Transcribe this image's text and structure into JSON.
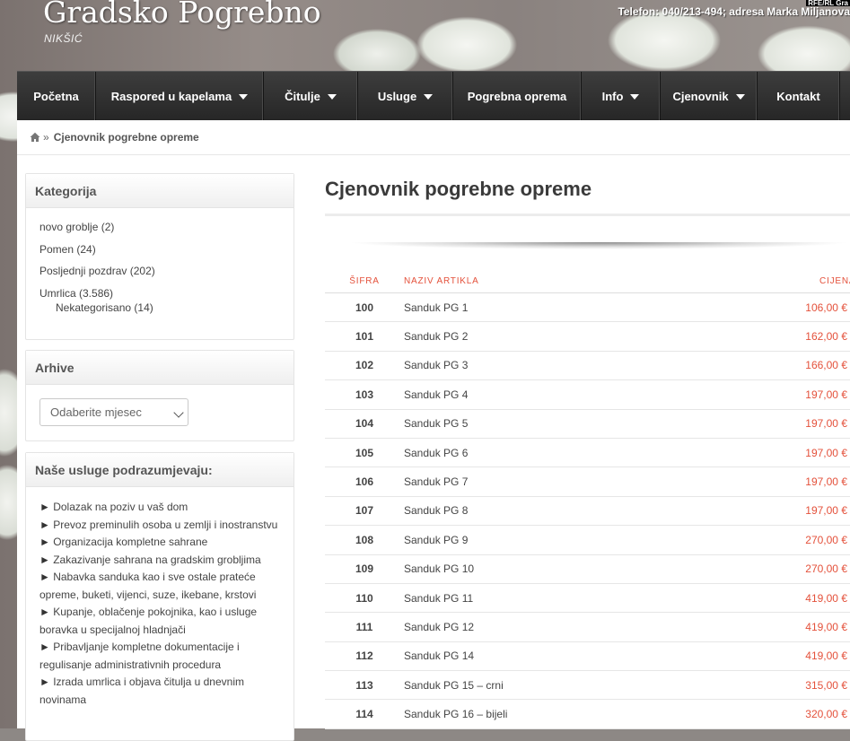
{
  "header": {
    "title": "Gradsko Pogrebno",
    "subtitle": "NIKŠIĆ",
    "contact": "Telefon: 040/213-494; adresa Marka Miljanova",
    "corner_badge": "RFE/RL Gra"
  },
  "nav": {
    "items": [
      {
        "label": "Početna",
        "has_dropdown": false
      },
      {
        "label": "Raspored u kapelama",
        "has_dropdown": true
      },
      {
        "label": "Čitulje",
        "has_dropdown": true
      },
      {
        "label": "Usluge",
        "has_dropdown": true
      },
      {
        "label": "Pogrebna oprema",
        "has_dropdown": false
      },
      {
        "label": "Info",
        "has_dropdown": true
      },
      {
        "label": "Cjenovnik",
        "has_dropdown": true
      },
      {
        "label": "Kontakt",
        "has_dropdown": false
      }
    ]
  },
  "breadcrumb": {
    "separator": "»",
    "current": "Cjenovnik pogrebne opreme",
    "home_icon": "home-icon"
  },
  "sidebar": {
    "categories": {
      "title": "Kategorija",
      "items": [
        {
          "label": "novo groblje",
          "count": "(2)"
        },
        {
          "label": "Pomen",
          "count": "(24)"
        },
        {
          "label": "Posljednji pozdrav",
          "count": "(202)"
        },
        {
          "label": "Umrlica",
          "count": "(3.586)"
        },
        {
          "label": "Nekategorisano",
          "count": "(14)"
        }
      ]
    },
    "archive": {
      "title": "Arhive",
      "select_value": "Odaberite mjesec"
    },
    "services": {
      "title": "Naše usluge podrazumjevaju:",
      "items": [
        "Dolazak na poziv u vaš dom",
        "Prevoz preminulih osoba u zemlji i inostranstvu",
        "Organizacija kompletne sahrane",
        "Zakazivanje sahrana na gradskim grobljima",
        "Nabavka sanduka kao i sve ostale prateće opreme, buketi, vijenci, suze, ikebane, krstovi",
        "Kupanje, oblačenje pokojnika, kao i usluge boravka u specijalnoj hladnjači",
        "Pribavljanje kompletne dokumentacije i regulisanje administrativnih procedura",
        "Izrada umrlica i objava čitulja u dnevnim novinama"
      ]
    }
  },
  "content": {
    "title": "Cjenovnik pogrebne opreme",
    "table": {
      "headers": [
        "ŠIFRA",
        "NAZIV ARTIKLA",
        "CIJENA"
      ],
      "rows": [
        {
          "code": "100",
          "name": "Sanduk PG 1",
          "price": "106,00 €"
        },
        {
          "code": "101",
          "name": "Sanduk PG 2",
          "price": "162,00 €"
        },
        {
          "code": "102",
          "name": "Sanduk PG 3",
          "price": "166,00 €"
        },
        {
          "code": "103",
          "name": "Sanduk PG 4",
          "price": "197,00 €"
        },
        {
          "code": "104",
          "name": "Sanduk PG 5",
          "price": "197,00 €"
        },
        {
          "code": "105",
          "name": "Sanduk PG 6",
          "price": "197,00 €"
        },
        {
          "code": "106",
          "name": "Sanduk PG 7",
          "price": "197,00 €"
        },
        {
          "code": "107",
          "name": "Sanduk PG 8",
          "price": "197,00 €"
        },
        {
          "code": "108",
          "name": "Sanduk PG 9",
          "price": "270,00 €"
        },
        {
          "code": "109",
          "name": "Sanduk PG 10",
          "price": "270,00 €"
        },
        {
          "code": "110",
          "name": "Sanduk PG 11",
          "price": "419,00 €"
        },
        {
          "code": "111",
          "name": "Sanduk PG 12",
          "price": "419,00 €"
        },
        {
          "code": "112",
          "name": "Sanduk PG 14",
          "price": "419,00 €"
        },
        {
          "code": "113",
          "name": "Sanduk PG 15 – crni",
          "price": "315,00 €"
        },
        {
          "code": "114",
          "name": "Sanduk PG 16 – bijeli",
          "price": "320,00 €"
        }
      ]
    }
  },
  "colors": {
    "accent": "#e4513b",
    "nav_bg": "#2f2f2f",
    "text": "#444444"
  }
}
